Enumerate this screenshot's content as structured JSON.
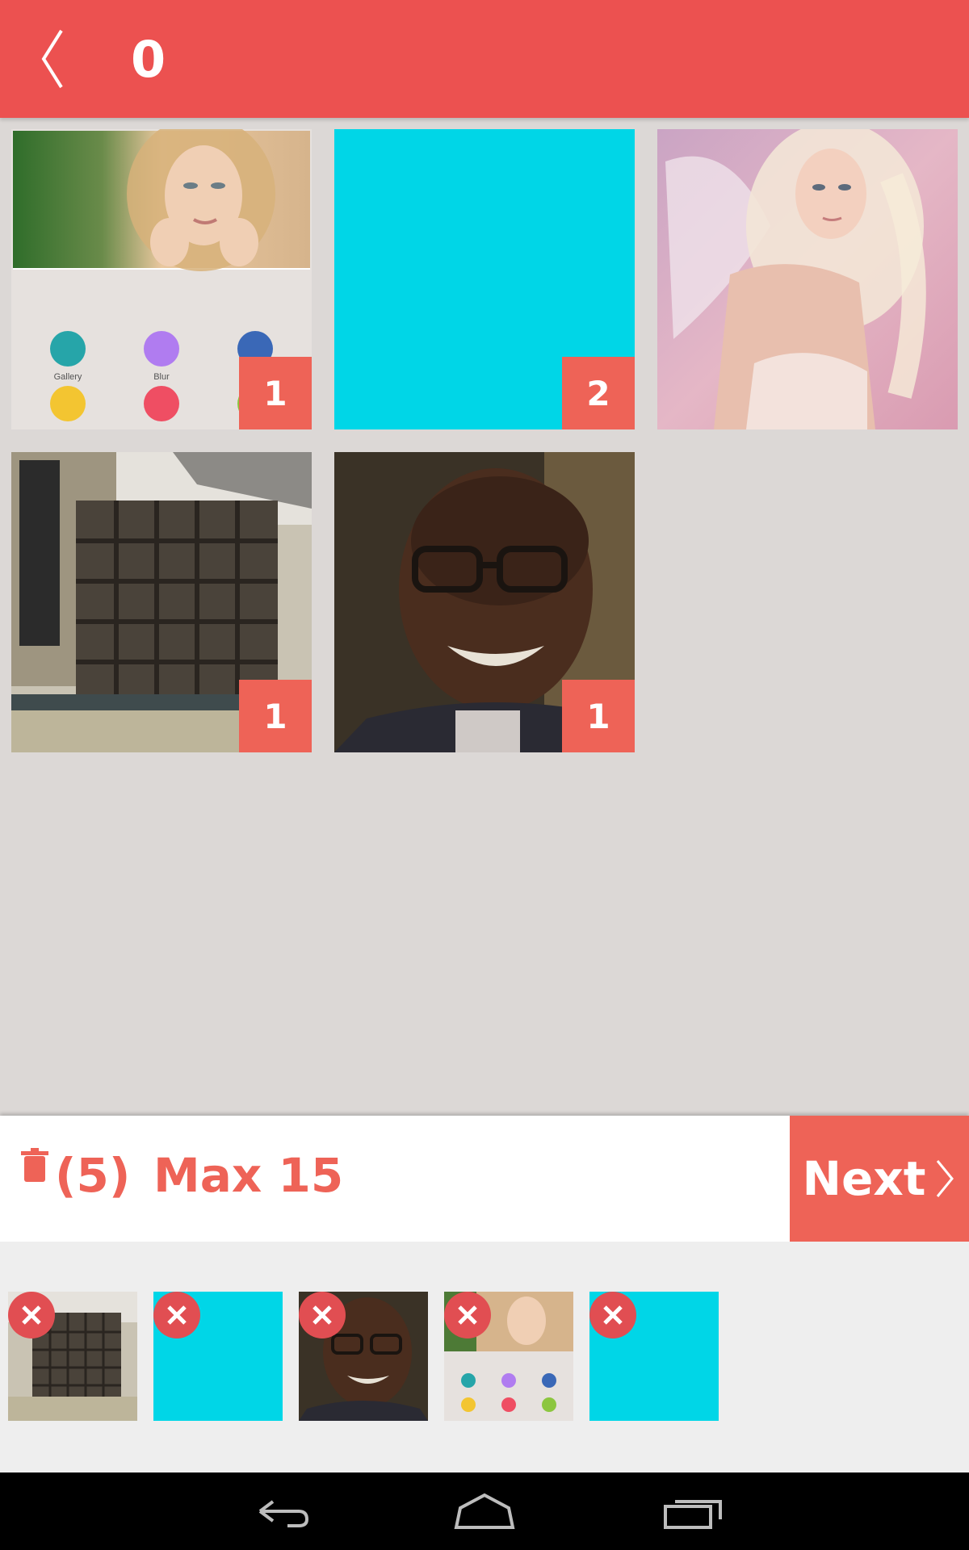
{
  "header": {
    "back_icon": "chevron-left-icon",
    "title": "0",
    "color": "#ec5150"
  },
  "grid": {
    "tiles": [
      {
        "kind": "photo-screenshot",
        "badge": "1"
      },
      {
        "kind": "cyan",
        "badge": "2"
      },
      {
        "kind": "photo-angel",
        "badge": null
      },
      {
        "kind": "photo-wall",
        "badge": "1"
      },
      {
        "kind": "photo-man",
        "badge": "1"
      }
    ]
  },
  "screenshot_tile": {
    "labels": [
      "Gallery",
      "Blur"
    ]
  },
  "actionbar": {
    "trash_icon": "trash-icon",
    "count": "(5)",
    "max": "Max 15",
    "next_label": "Next",
    "accent": "#ee6357"
  },
  "strip": {
    "items": [
      {
        "kind": "photo-wall",
        "remove_icon": "close-icon"
      },
      {
        "kind": "cyan",
        "remove_icon": "close-icon"
      },
      {
        "kind": "photo-man",
        "remove_icon": "close-icon"
      },
      {
        "kind": "photo-screenshot",
        "remove_icon": "close-icon"
      },
      {
        "kind": "cyan",
        "remove_icon": "close-icon"
      }
    ]
  },
  "navbar": {
    "icons": [
      "back-nav-icon",
      "home-nav-icon",
      "recents-nav-icon"
    ]
  }
}
